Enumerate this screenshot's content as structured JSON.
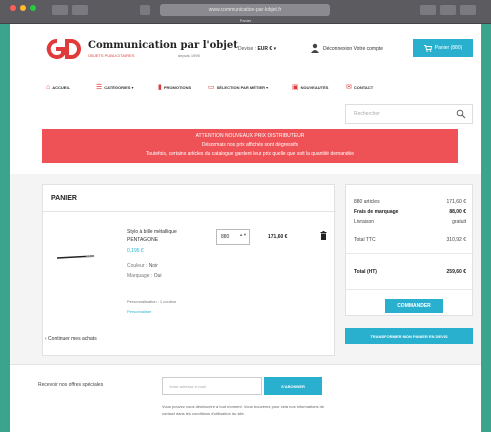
{
  "browser": {
    "url": "www.communication-par-lobjet.fr",
    "tab_title": "Panier",
    "dot_colors": [
      "#ff5f57",
      "#febc2e",
      "#28c840"
    ]
  },
  "brand": {
    "name": "Communication par l'objet",
    "tagline": "OBJETS PUBLICITAIRES",
    "since": "depuis 1995",
    "accent": "#e03a3a",
    "primary": "#2ab0cf"
  },
  "header": {
    "currency_label": "Devise :",
    "currency_value": "EUR € ▾",
    "user_links": "Déconnexion   Votre compte",
    "cart_label": "Panier (880)",
    "cart_icon": "cart-icon",
    "user_icon": "user-icon"
  },
  "nav": {
    "items": [
      {
        "label": "ACCUEIL",
        "icon": "home-icon"
      },
      {
        "label": "CATÉGORIES ▾",
        "icon": "list-icon"
      },
      {
        "label": "PROMOTIONS",
        "icon": "tag-icon"
      },
      {
        "label": "SÉLECTION PAR MÉTIER ▾",
        "icon": "briefcase-icon"
      },
      {
        "label": "NOUVEAUTÉS",
        "icon": "gift-icon"
      },
      {
        "label": "CONTACT",
        "icon": "mail-icon"
      }
    ]
  },
  "search": {
    "placeholder": "Rechercher",
    "icon": "search-icon"
  },
  "notice": {
    "lines": [
      "ATTENTION NOUVEAUX PRIX DISTRIBUTEUR",
      "Désormais nos prix affichés sont dégressifs",
      "Toutefois, certains articles du catalogue gardent leur prix quelle que soit la quantité demandée"
    ],
    "color": "#ee5257"
  },
  "cart": {
    "title": "PANIER",
    "item": {
      "name": "Stylo à bille métallique PENTAGONE",
      "unit_price": "0,195 €",
      "attributes": [
        {
          "label": "Couleur :",
          "value": "Noir"
        },
        {
          "label": "Marquage :",
          "value": "Oui"
        }
      ],
      "quantity": "880",
      "quantity_arrows": "▲▼",
      "line_total": "171,60 €",
      "reference": "Personnalisation : 1 couleur",
      "link_label": "Personnaliser"
    },
    "trash_icon": "trash-icon",
    "continue_label": "‹ Continuer mes achats"
  },
  "summary": {
    "rows": [
      {
        "label": "880 articles",
        "value": "171,60 €",
        "bold": false
      },
      {
        "label": "Frais de marquage",
        "value": "88,00 €",
        "bold": true
      },
      {
        "label": "Livraison",
        "value": "gratuit",
        "bold": false
      },
      {
        "label": "Total TTC",
        "value": "310,92 €",
        "bold": false
      },
      {
        "label": "Total (HT)",
        "value": "259,60 €",
        "bold": true
      }
    ],
    "checkout_label": "COMMANDER",
    "quote_label": "TRANSFORMER MON PANIER EN DEVIS"
  },
  "newsletter": {
    "label": "Recevoir nos offres spéciales",
    "placeholder": "Votre adresse e-mail",
    "button_label": "S'ABONNER",
    "info": "Vous pouvez vous désinscrire à tout moment. Vous trouverez pour cela nos informations de contact dans les conditions d'utilisation du site."
  }
}
